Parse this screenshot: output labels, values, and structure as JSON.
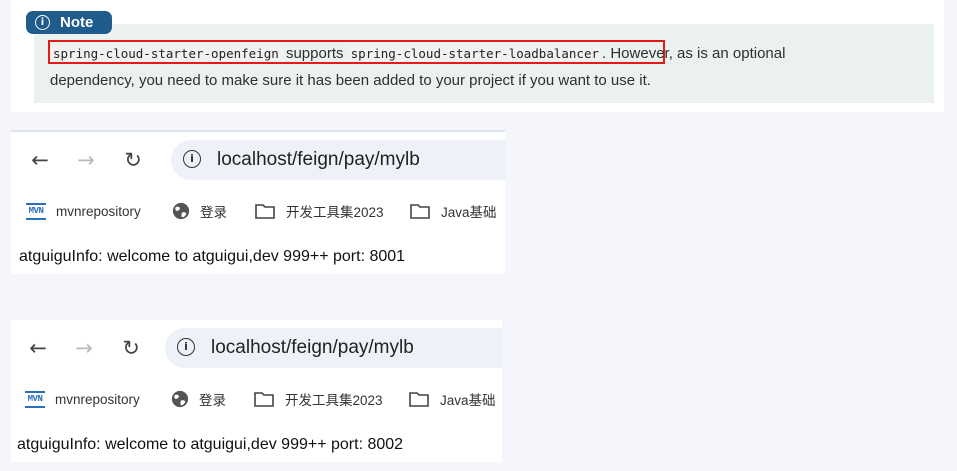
{
  "note": {
    "badge_label": "Note",
    "code1": "spring-cloud-starter-openfeign",
    "mid_text": " supports ",
    "code2": "spring-cloud-starter-loadbalancer",
    "tail_text": ". However, as is an optional",
    "line2": "dependency, you need to make sure it has been added to your project if you want to use it."
  },
  "browsers": [
    {
      "url": "localhost/feign/pay/mylb",
      "bookmarks": [
        {
          "label": "mvnrepository",
          "icon": "mvn-icon"
        },
        {
          "label": "登录",
          "icon": "globe-icon"
        },
        {
          "label": "开发工具集2023",
          "icon": "folder-icon"
        },
        {
          "label": "Java基础",
          "icon": "folder-icon"
        }
      ],
      "page_text": "atguiguInfo: welcome to atguigui,dev 999++ port: 8001"
    },
    {
      "url": "localhost/feign/pay/mylb",
      "bookmarks": [
        {
          "label": "mvnrepository",
          "icon": "mvn-icon"
        },
        {
          "label": "登录",
          "icon": "globe-icon"
        },
        {
          "label": "开发工具集2023",
          "icon": "folder-icon"
        },
        {
          "label": "Java基础",
          "icon": "folder-icon"
        }
      ],
      "page_text": "atguiguInfo: welcome to atguigui,dev 999++ port: 8002"
    }
  ],
  "icons": {
    "back": "back-arrow-icon",
    "forward": "forward-arrow-icon",
    "reload": "reload-icon",
    "site_info": "info-icon",
    "mvn_logo_text": "MVN"
  },
  "colors": {
    "note_badge": "#1f5c8b",
    "note_bg": "#eaf1ef",
    "highlight_border": "#e21a1a",
    "omnibox_bg": "#eef1f8"
  }
}
